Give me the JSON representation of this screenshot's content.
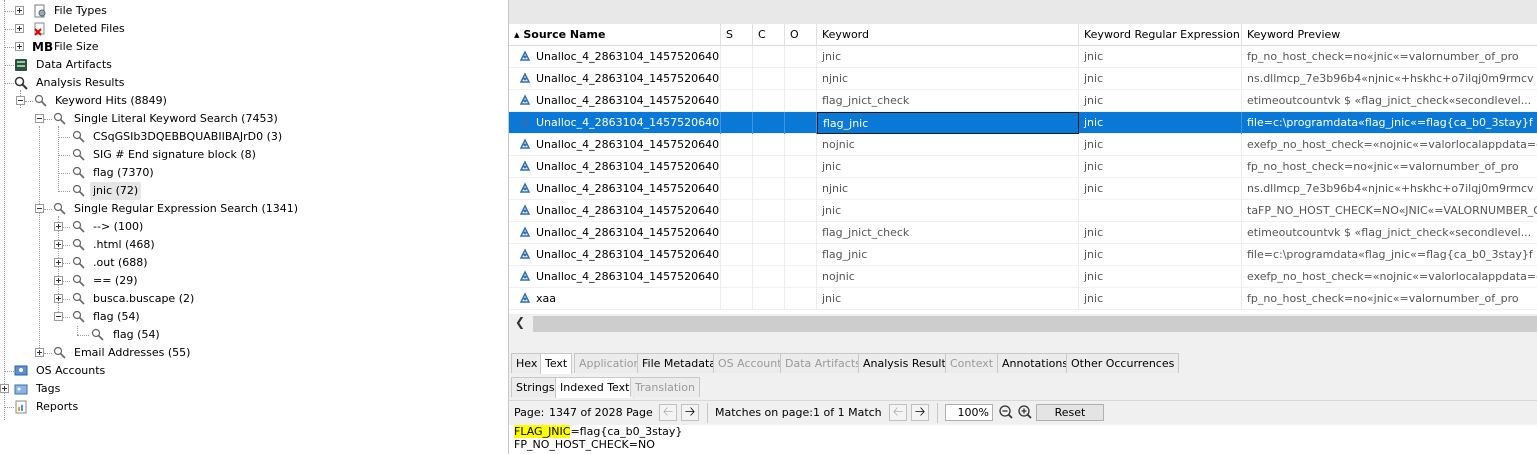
{
  "tree": {
    "file_types": "File Types",
    "deleted_files": "Deleted Files",
    "mb_badge": "MB",
    "file_size": "File Size",
    "data_artifacts": "Data Artifacts",
    "analysis_results": "Analysis Results",
    "keyword_hits": "Keyword Hits (8849)",
    "single_literal": "Single Literal Keyword Search (7453)",
    "lit_items": [
      "CSqGSIb3DQEBBQUABIIBAJrD0 (3)",
      "SIG # End signature block (8)",
      "flag (7370)",
      "jnic (72)"
    ],
    "single_regex": "Single Regular Expression Search (1341)",
    "regex_items": [
      "--> (100)",
      ".html (468)",
      ".out (688)",
      "== (29)",
      "busca.buscape (2)",
      "flag (54)"
    ],
    "regex_flag_child": "flag (54)",
    "email_addresses": "Email Addresses (55)",
    "os_accounts": "OS Accounts",
    "tags": "Tags",
    "reports": "Reports"
  },
  "table": {
    "headers": [
      "Source Name",
      "S",
      "C",
      "O",
      "Keyword",
      "Keyword Regular Expression",
      "Keyword Preview"
    ],
    "rows": [
      {
        "source": "Unalloc_4_2863104_1457520640",
        "keyword": "jnic",
        "regex": "jnic",
        "preview": "fp_no_host_check=no«jnic«=valornumber_of_pro"
      },
      {
        "source": "Unalloc_4_2863104_1457520640",
        "keyword": "njnic",
        "regex": "jnic",
        "preview": "ns.dllmcp_7e3b96b4«njnic«+hskhc+o7ilqj0m9rmcv"
      },
      {
        "source": "Unalloc_4_2863104_1457520640",
        "keyword": "flag_jnict_check",
        "regex": "jnic",
        "preview": "etimeoutcountvk        $       «flag_jnict_check«secondlevel..."
      },
      {
        "source": "Unalloc_4_2863104_1457520640",
        "keyword": "flag_jnic",
        "regex": "jnic",
        "preview": "file=c:\\programdata«flag_jnic«=flag{ca_b0_3stay}f"
      },
      {
        "source": "Unalloc_4_2863104_1457520640",
        "keyword": "nojnic",
        "regex": "jnic",
        "preview": "exefp_no_host_check=«nojnic«=valorlocalappdata=c"
      },
      {
        "source": "Unalloc_4_2863104_1457520640",
        "keyword": "jnic",
        "regex": "jnic",
        "preview": "fp_no_host_check=no«jnic«=valornumber_of_pro"
      },
      {
        "source": "Unalloc_4_2863104_1457520640",
        "keyword": "njnic",
        "regex": "jnic",
        "preview": "ns.dllmcp_7e3b96b4«njnic«+hskhc+o7ilqj0m9rmcv"
      },
      {
        "source": "Unalloc_4_2863104_1457520640",
        "keyword": "jnic",
        "regex": "",
        "preview": "taFP_NO_HOST_CHECK=NO«JNIC«=VALORNUMBER_OF_..."
      },
      {
        "source": "Unalloc_4_2863104_1457520640",
        "keyword": "flag_jnict_check",
        "regex": "jnic",
        "preview": "etimeoutcountvk        $       «flag_jnict_check«secondlevel..."
      },
      {
        "source": "Unalloc_4_2863104_1457520640",
        "keyword": "flag_jnic",
        "regex": "jnic",
        "preview": "file=c:\\programdata«flag_jnic«=flag{ca_b0_3stay}f"
      },
      {
        "source": "Unalloc_4_2863104_1457520640",
        "keyword": "nojnic",
        "regex": "jnic",
        "preview": "exefp_no_host_check=«nojnic«=valorlocalappdata=c"
      },
      {
        "source": "xaa",
        "keyword": "jnic",
        "regex": "jnic",
        "preview": "fp_no_host_check=no«jnic«=valornumber_of_pro"
      }
    ],
    "selected_row": 3
  },
  "viewer_tabs": [
    "Hex",
    "Text",
    "Application",
    "File Metadata",
    "OS Account",
    "Data Artifacts",
    "Analysis Results",
    "Context",
    "Annotations",
    "Other Occurrences"
  ],
  "text_subtabs": [
    "Strings",
    "Indexed Text",
    "Translation"
  ],
  "toolbar": {
    "page_label": "Page:",
    "page_value": "1347 of 2028 Page",
    "matches_label": "Matches on page:",
    "matches_value": "1  of  1 Match",
    "zoom": "100%",
    "reset": "Reset"
  },
  "text_content": {
    "line1_highlight": "FLAG_JNIC",
    "line1_rest": "=flag{ca_b0_3stay}",
    "line2": "FP_NO_HOST_CHECK=NO"
  },
  "colors": {
    "selection": "#0a78d7",
    "highlight": "#ffff00"
  }
}
